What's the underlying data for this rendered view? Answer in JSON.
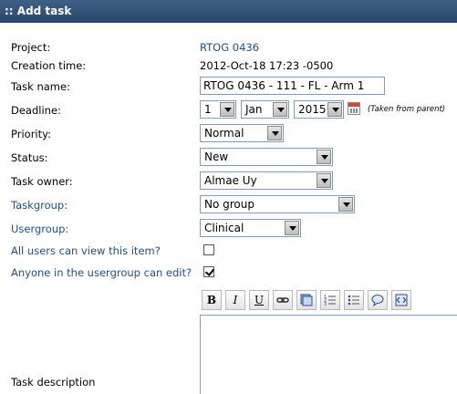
{
  "header": {
    "title": ":: Add task"
  },
  "fields": {
    "project": {
      "label": "Project:",
      "value": "RTOG 0436"
    },
    "creation_time": {
      "label": "Creation time:",
      "value": "2012-Oct-18 17:23  -0500"
    },
    "task_name": {
      "label": "Task name:",
      "value": "RTOG 0436 - 111 - FL - Arm 1"
    },
    "deadline": {
      "label": "Deadline:",
      "day": "1",
      "month": "Jan",
      "year": "2015",
      "note": "(Taken from parent)"
    },
    "priority": {
      "label": "Priority:",
      "value": "Normal"
    },
    "status": {
      "label": "Status:",
      "value": "New"
    },
    "task_owner": {
      "label": "Task owner:",
      "value": "Almae Uy"
    },
    "taskgroup": {
      "label": "Taskgroup:",
      "value": "No group"
    },
    "usergroup": {
      "label": "Usergroup:",
      "value": "Clinical"
    },
    "all_users_view": {
      "label": "All users can view this item?",
      "checked": false
    },
    "usergroup_edit": {
      "label": "Anyone in the usergroup can edit?",
      "checked": true
    },
    "task_description": {
      "label": "Task description"
    }
  },
  "toolbar": {
    "bold": "B",
    "italic": "I",
    "underline": "U",
    "icons": [
      "link-icon",
      "image-icon",
      "ordered-list-icon",
      "unordered-list-icon",
      "comment-icon",
      "source-icon"
    ]
  },
  "colors": {
    "header_bg": "#2f4f78",
    "link": "#1f4e8c"
  }
}
